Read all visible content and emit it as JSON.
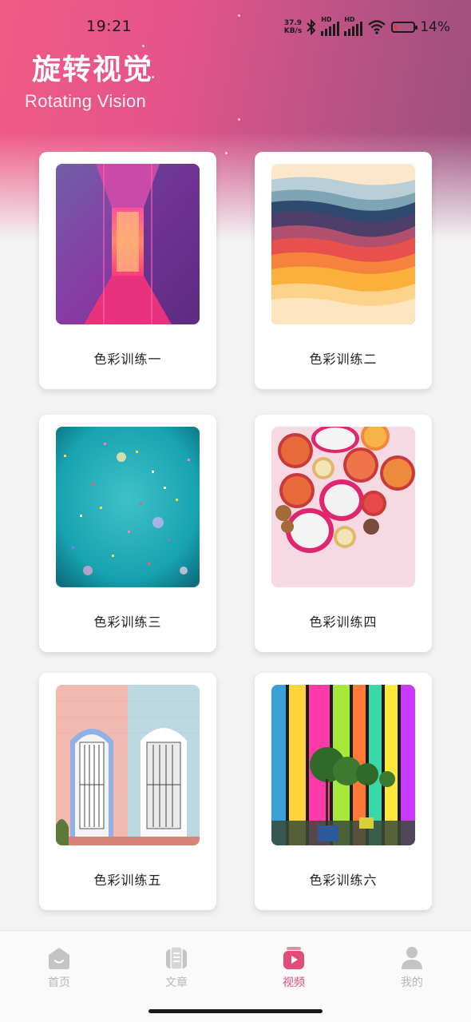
{
  "status_bar": {
    "time": "19:21",
    "net_speed_value": "37.9",
    "net_speed_unit": "KB/s",
    "sim1_label": "HD",
    "sim2_label": "HD",
    "battery_percent": "14%",
    "battery_level": 0.14
  },
  "header": {
    "title": "旋转视觉",
    "subtitle": "Rotating Vision"
  },
  "cards": [
    {
      "label": "色彩训练一",
      "image": "neon-corridor"
    },
    {
      "label": "色彩训练二",
      "image": "layered-color-waves"
    },
    {
      "label": "色彩训练三",
      "image": "confetti-on-teal"
    },
    {
      "label": "色彩训练四",
      "image": "citrus-and-dragonfruit"
    },
    {
      "label": "色彩训练五",
      "image": "pastel-doorways"
    },
    {
      "label": "色彩训练六",
      "image": "stained-glass-corridor"
    }
  ],
  "tabbar": {
    "tabs": [
      {
        "label": "首页",
        "icon": "home-icon",
        "active": false
      },
      {
        "label": "文章",
        "icon": "article-icon",
        "active": false
      },
      {
        "label": "视频",
        "icon": "video-icon",
        "active": true
      },
      {
        "label": "我的",
        "icon": "profile-icon",
        "active": false
      }
    ]
  },
  "colors": {
    "accent": "#e24c79",
    "header_start": "#f05a86",
    "header_end": "#9a4f7e",
    "tab_inactive": "#b8b8b8"
  }
}
